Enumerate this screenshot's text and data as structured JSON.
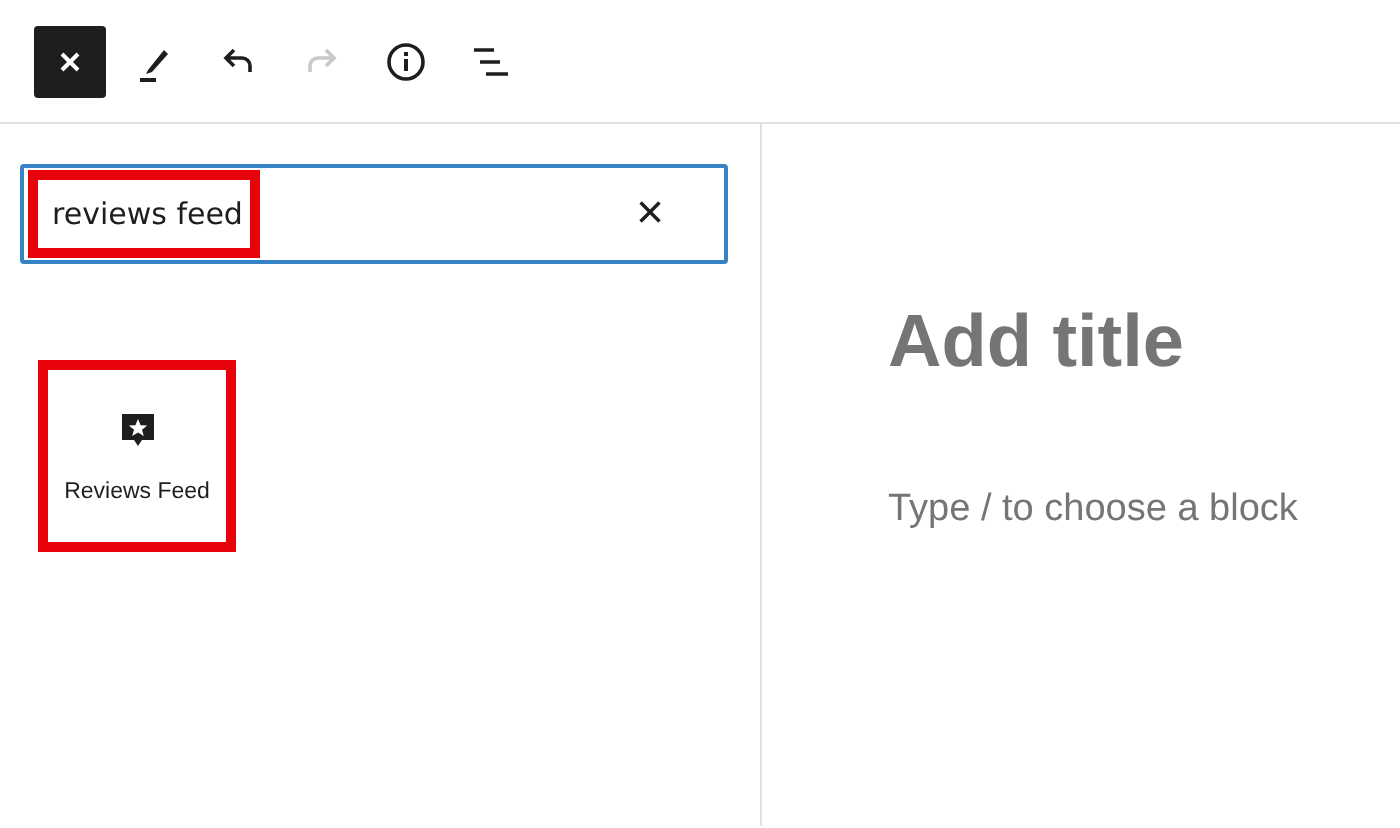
{
  "toolbar": {
    "buttons": [
      {
        "kind": "close",
        "disabled": false
      },
      {
        "kind": "edit",
        "disabled": false
      },
      {
        "kind": "undo",
        "disabled": false
      },
      {
        "kind": "redo",
        "disabled": true
      },
      {
        "kind": "info",
        "disabled": false
      },
      {
        "kind": "outline",
        "disabled": false
      }
    ]
  },
  "inserter": {
    "search": {
      "value": "reviews feed",
      "highlighted": true
    },
    "clear": "×",
    "blocks": [
      {
        "label": "Reviews Feed",
        "highlighted": true
      }
    ]
  },
  "editor": {
    "title_placeholder": "Add title",
    "block_placeholder": "Type / to choose a block"
  }
}
